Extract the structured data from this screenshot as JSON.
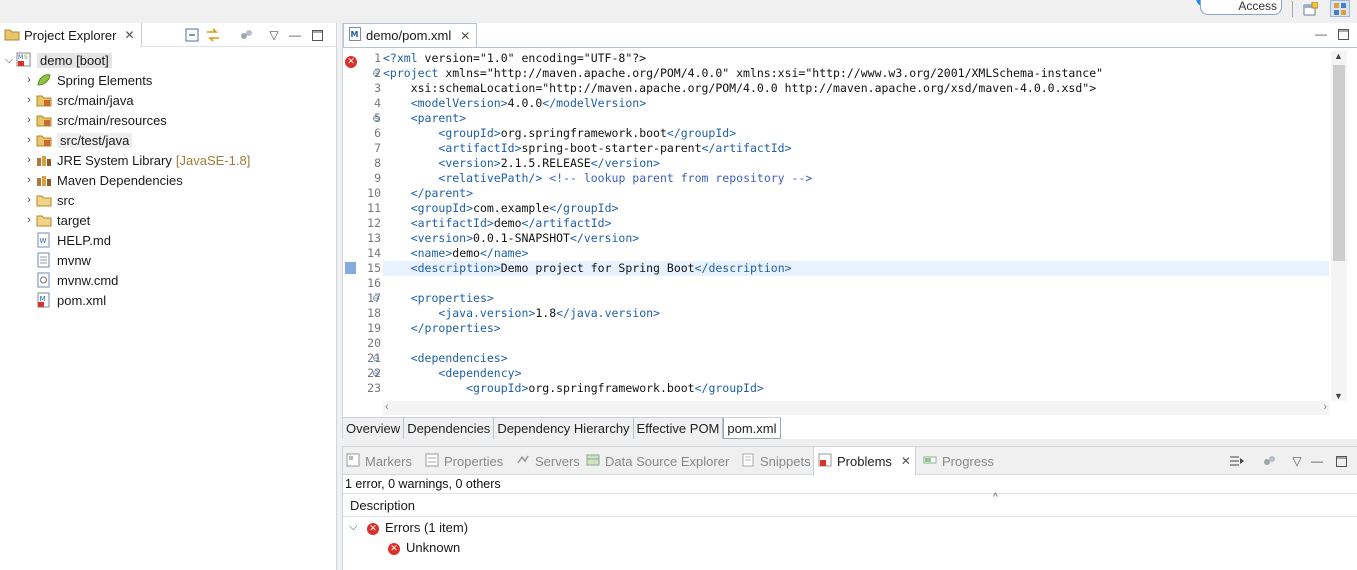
{
  "top": {
    "quick_access": "Access"
  },
  "project_explorer": {
    "tab_label": "Project Explorer",
    "items": [
      {
        "label": "demo",
        "decoration": "[boot]"
      },
      {
        "label": "Spring Elements",
        "decoration": ""
      },
      {
        "label": "src/main/java",
        "decoration": ""
      },
      {
        "label": "src/main/resources",
        "decoration": ""
      },
      {
        "label": "src/test/java",
        "decoration": ""
      },
      {
        "label": "JRE System Library",
        "decoration": "[JavaSE-1.8]"
      },
      {
        "label": "Maven Dependencies",
        "decoration": ""
      },
      {
        "label": "src",
        "decoration": ""
      },
      {
        "label": "target",
        "decoration": ""
      },
      {
        "label": "HELP.md",
        "decoration": ""
      },
      {
        "label": "mvnw",
        "decoration": ""
      },
      {
        "label": "mvnw.cmd",
        "decoration": ""
      },
      {
        "label": "pom.xml",
        "decoration": ""
      }
    ]
  },
  "editor": {
    "tab_label": "demo/pom.xml",
    "line_numbers": [
      "1",
      "2",
      "3",
      "4",
      "5",
      "6",
      "7",
      "8",
      "9",
      "10",
      "11",
      "12",
      "13",
      "14",
      "15",
      "16",
      "17",
      "18",
      "19",
      "20",
      "21",
      "22",
      "23"
    ],
    "lines": [
      "<?xml version=\"1.0\" encoding=\"UTF-8\"?>",
      "<project xmlns=\"http://maven.apache.org/POM/4.0.0\" xmlns:xsi=\"http://www.w3.org/2001/XMLSchema-instance\"",
      "    xsi:schemaLocation=\"http://maven.apache.org/POM/4.0.0 http://maven.apache.org/xsd/maven-4.0.0.xsd\">",
      "    <modelVersion>4.0.0</modelVersion>",
      "    <parent>",
      "        <groupId>org.springframework.boot</groupId>",
      "        <artifactId>spring-boot-starter-parent</artifactId>",
      "        <version>2.1.5.RELEASE</version>",
      "        <relativePath/> <!-- lookup parent from repository -->",
      "    </parent>",
      "    <groupId>com.example</groupId>",
      "    <artifactId>demo</artifactId>",
      "    <version>0.0.1-SNAPSHOT</version>",
      "    <name>demo</name>",
      "    <description>Demo project for Spring Boot</description>",
      "",
      "    <properties>",
      "        <java.version>1.8</java.version>",
      "    </properties>",
      "",
      "    <dependencies>",
      "        <dependency>",
      "            <groupId>org.springframework.boot</groupId>"
    ],
    "pom_tabs": [
      "Overview",
      "Dependencies",
      "Dependency Hierarchy",
      "Effective POM",
      "pom.xml"
    ]
  },
  "problems_view": {
    "tabs": [
      "Markers",
      "Properties",
      "Servers",
      "Data Source Explorer",
      "Snippets",
      "Problems",
      "Progress"
    ],
    "summary": "1 error, 0 warnings, 0 others",
    "column_description": "Description",
    "group_label": "Errors (1 item)",
    "item_label": "Unknown"
  }
}
